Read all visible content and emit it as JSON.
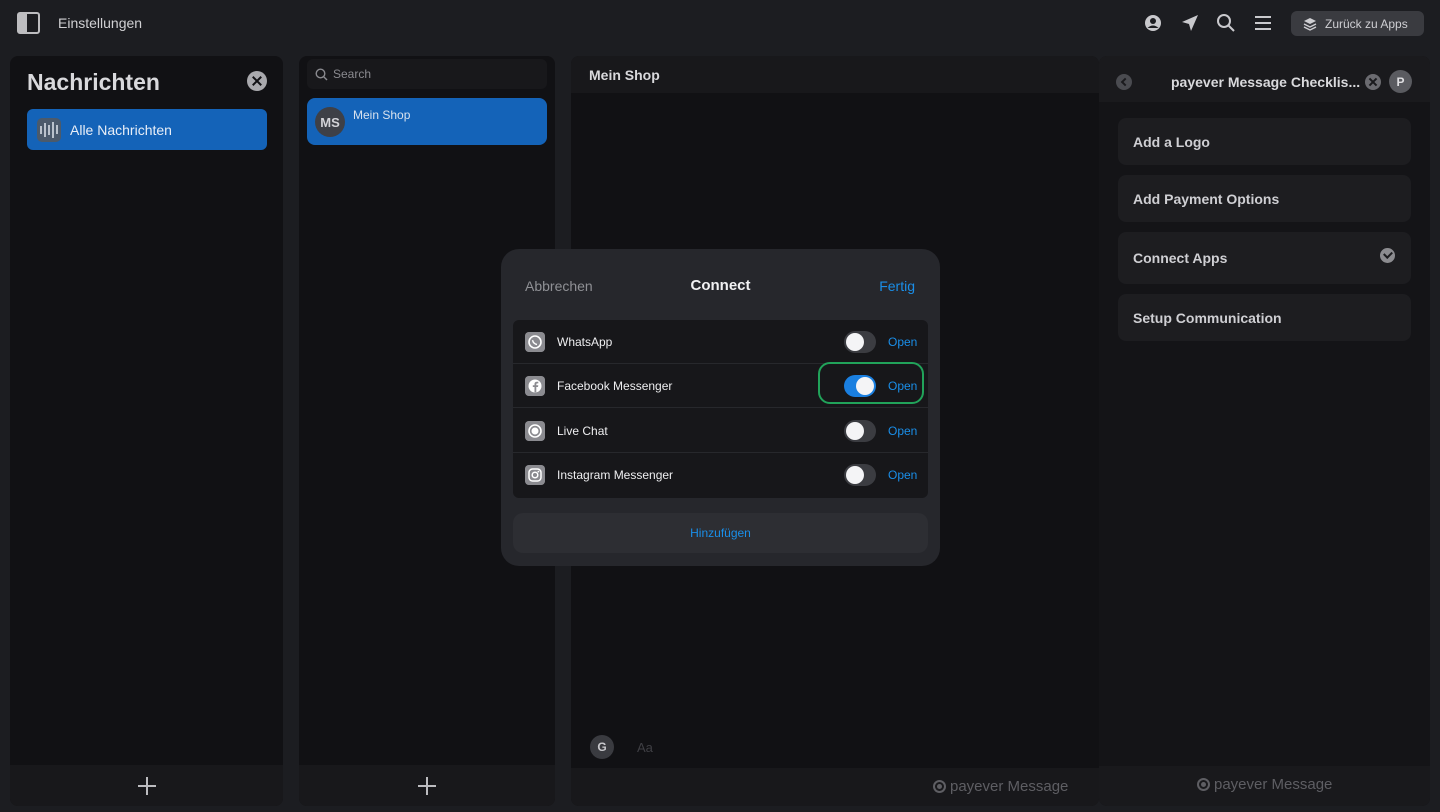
{
  "topbar": {
    "title": "Einstellungen",
    "back_label": "Zurück zu Apps"
  },
  "left": {
    "title": "Nachrichten",
    "all_messages": "Alle Nachrichten"
  },
  "list": {
    "search_placeholder": "Search",
    "chat": {
      "initials": "MS",
      "name": "Mein Shop"
    }
  },
  "main": {
    "title": "Mein Shop",
    "user_initial": "G",
    "composer_placeholder": "Aa",
    "brand": "payever Message"
  },
  "right": {
    "title": "payever Message Checklis...",
    "avatar": "P",
    "items": [
      {
        "label": "Add a Logo",
        "done": false
      },
      {
        "label": "Add Payment Options",
        "done": false
      },
      {
        "label": "Connect Apps",
        "done": true
      },
      {
        "label": "Setup Communication",
        "done": false
      }
    ],
    "brand": "payever Message"
  },
  "modal": {
    "cancel": "Abbrechen",
    "title": "Connect",
    "done": "Fertig",
    "apps": [
      {
        "name": "WhatsApp",
        "icon": "whatsapp-icon",
        "enabled": false,
        "action": "Open"
      },
      {
        "name": "Facebook Messenger",
        "icon": "facebook-icon",
        "enabled": true,
        "action": "Open"
      },
      {
        "name": "Live Chat",
        "icon": "live-chat-icon",
        "enabled": false,
        "action": "Open"
      },
      {
        "name": "Instagram Messenger",
        "icon": "instagram-icon",
        "enabled": false,
        "action": "Open"
      }
    ],
    "add_label": "Hinzufügen"
  },
  "colors": {
    "accent": "#1a8ee8",
    "selected": "#1463b8",
    "focus": "#21a35a"
  }
}
